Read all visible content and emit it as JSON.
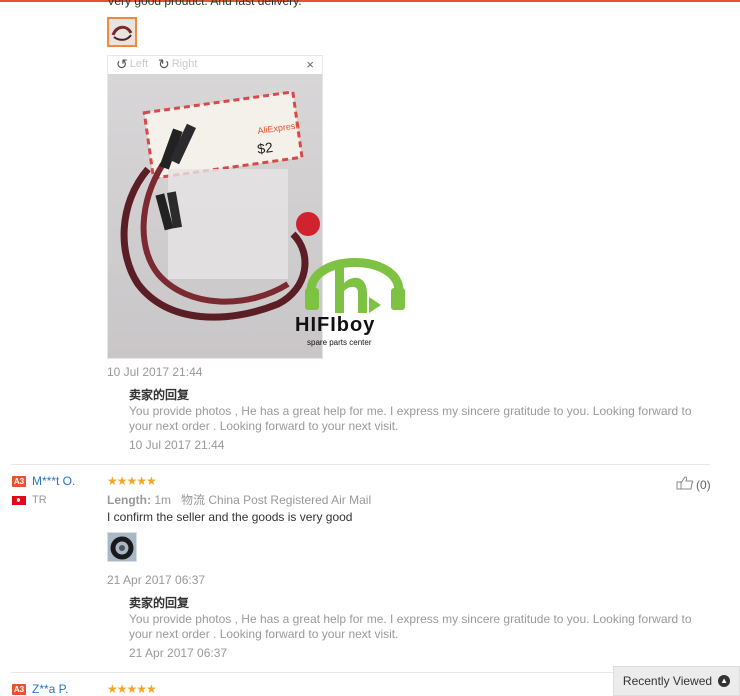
{
  "previous_review": {
    "text": "Very good product. And fast delivery."
  },
  "viewer": {
    "rotate_left": "Left",
    "rotate_right": "Right",
    "close": "×",
    "watermark": {
      "brand": "HIFIboy",
      "tagline": "spare parts center"
    },
    "package_text": {
      "logo": "AliExpress",
      "price": "$2"
    }
  },
  "review1_dates": {
    "posted": "10 Jul 2017 21:44"
  },
  "reply1": {
    "title": "卖家的回复",
    "body": "You provide photos , He has a great help for me. I express my sincere gratitude to you. Looking forward to your next order . Looking forward to your next visit.",
    "date": "10 Jul 2017 21:44"
  },
  "review2": {
    "badge": "A3",
    "username": "M***t O.",
    "country": "TR",
    "stars": "★★★★★",
    "length_label": "Length:",
    "length_value": "1m",
    "shipping_label": "物流",
    "shipping_value": "China Post Registered Air Mail",
    "text": "I confirm the seller and the goods is very good",
    "helpful_count": "(0)",
    "date": "21 Apr 2017 06:37"
  },
  "reply2": {
    "title": "卖家的回复",
    "body": "You provide photos , He has a great help for me. I express my sincere gratitude to you. Looking forward to your next order . Looking forward to your next visit.",
    "date": "21 Apr 2017 06:37"
  },
  "review3": {
    "badge": "A3",
    "username": "Z**a P.",
    "stars": "★★★★★"
  },
  "recently_viewed": {
    "label": "Recently Viewed"
  },
  "colors": {
    "accent": "#e8522e",
    "star": "#f5a623",
    "link": "#2673c6",
    "logo_green": "#7dc242"
  }
}
